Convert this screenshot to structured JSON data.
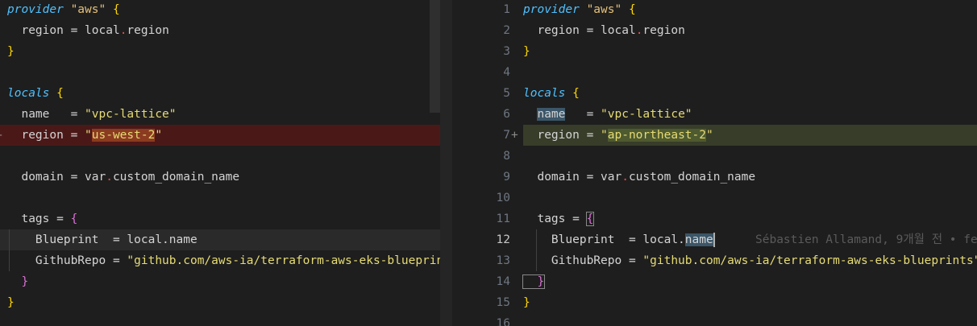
{
  "left_lines": [
    {
      "parts": [
        [
          "kw",
          "provider"
        ],
        [
          "op",
          " "
        ],
        [
          "str-y",
          "\"aws\""
        ],
        [
          "op",
          " "
        ],
        [
          "brace-y",
          "{"
        ]
      ]
    },
    {
      "parts": [
        [
          "op",
          "  region = local"
        ],
        [
          "dot",
          "."
        ],
        [
          "op",
          "region"
        ]
      ]
    },
    {
      "parts": [
        [
          "brace-y",
          "}"
        ]
      ]
    },
    {
      "parts": []
    },
    {
      "parts": [
        [
          "kw",
          "locals"
        ],
        [
          "op",
          " "
        ],
        [
          "brace-y",
          "{"
        ]
      ]
    },
    {
      "parts": [
        [
          "op",
          "  name   = "
        ],
        [
          "str-y2",
          "\"vpc-lattice\""
        ]
      ]
    },
    {
      "parts": [
        [
          "op",
          "  region = "
        ],
        [
          "str-y2",
          "\""
        ],
        [
          "str-y2 word-rem",
          "us-west-2"
        ],
        [
          "str-y2",
          "\""
        ]
      ],
      "kind": "removed",
      "marker": "-"
    },
    {
      "parts": []
    },
    {
      "parts": [
        [
          "op",
          "  domain = var"
        ],
        [
          "dot",
          "."
        ],
        [
          "op",
          "custom_domain_name"
        ]
      ]
    },
    {
      "parts": []
    },
    {
      "parts": [
        [
          "op",
          "  tags = "
        ],
        [
          "brace-p",
          "{"
        ]
      ]
    },
    {
      "parts": [
        [
          "op",
          "    Blueprint  = local.name"
        ]
      ],
      "kind": "highlight"
    },
    {
      "parts": [
        [
          "op",
          "    GithubRepo = "
        ],
        [
          "str-y2",
          "\"github.com/aws-ia/terraform-aws-eks-blueprints\""
        ]
      ]
    },
    {
      "parts": [
        [
          "brace-p",
          "  }"
        ]
      ]
    },
    {
      "parts": [
        [
          "brace-y",
          "}"
        ]
      ]
    }
  ],
  "right_lines": [
    {
      "num": "1",
      "parts": [
        [
          "kw",
          "provider"
        ],
        [
          "op",
          " "
        ],
        [
          "str-y",
          "\"aws\""
        ],
        [
          "op",
          " "
        ],
        [
          "brace-y",
          "{"
        ]
      ]
    },
    {
      "num": "2",
      "parts": [
        [
          "op",
          "  region = local"
        ],
        [
          "dot",
          "."
        ],
        [
          "op",
          "region"
        ]
      ]
    },
    {
      "num": "3",
      "parts": [
        [
          "brace-y",
          "}"
        ]
      ]
    },
    {
      "num": "4",
      "parts": []
    },
    {
      "num": "5",
      "parts": [
        [
          "kw",
          "locals"
        ],
        [
          "op",
          " "
        ],
        [
          "brace-y",
          "{"
        ]
      ]
    },
    {
      "num": "6",
      "parts": [
        [
          "op",
          "  "
        ],
        [
          "op word-hl",
          "name"
        ],
        [
          "op",
          "   = "
        ],
        [
          "str-y2",
          "\"vpc-lattice\""
        ]
      ]
    },
    {
      "num": "7",
      "parts": [
        [
          "op",
          "  region = "
        ],
        [
          "str-y2",
          "\""
        ],
        [
          "str-y2 word-add",
          "ap-northeast-2"
        ],
        [
          "str-y2",
          "\""
        ]
      ],
      "kind": "added",
      "marker": "+"
    },
    {
      "num": "8",
      "parts": []
    },
    {
      "num": "9",
      "parts": [
        [
          "op",
          "  domain = var"
        ],
        [
          "dot",
          "."
        ],
        [
          "op",
          "custom_domain_name"
        ]
      ]
    },
    {
      "num": "10",
      "parts": []
    },
    {
      "num": "11",
      "parts": [
        [
          "op",
          "  tags = "
        ],
        [
          "brace-p bracket-box",
          "{"
        ]
      ]
    },
    {
      "num": "12",
      "parts": [
        [
          "op",
          "    Blueprint  = local."
        ],
        [
          "op word-hl",
          "name"
        ]
      ],
      "active": true,
      "blame": "Sébastien Allamand, 9개월 전 • fe"
    },
    {
      "num": "13",
      "parts": [
        [
          "op",
          "    GithubRepo = "
        ],
        [
          "str-y2",
          "\"github.com/aws-ia/terraform-aws-eks-blueprints\""
        ]
      ]
    },
    {
      "num": "14",
      "parts": [
        [
          "brace-p bracket-box",
          "  }"
        ]
      ]
    },
    {
      "num": "15",
      "parts": [
        [
          "brace-y",
          "}"
        ]
      ]
    },
    {
      "num": "16",
      "parts": []
    }
  ]
}
